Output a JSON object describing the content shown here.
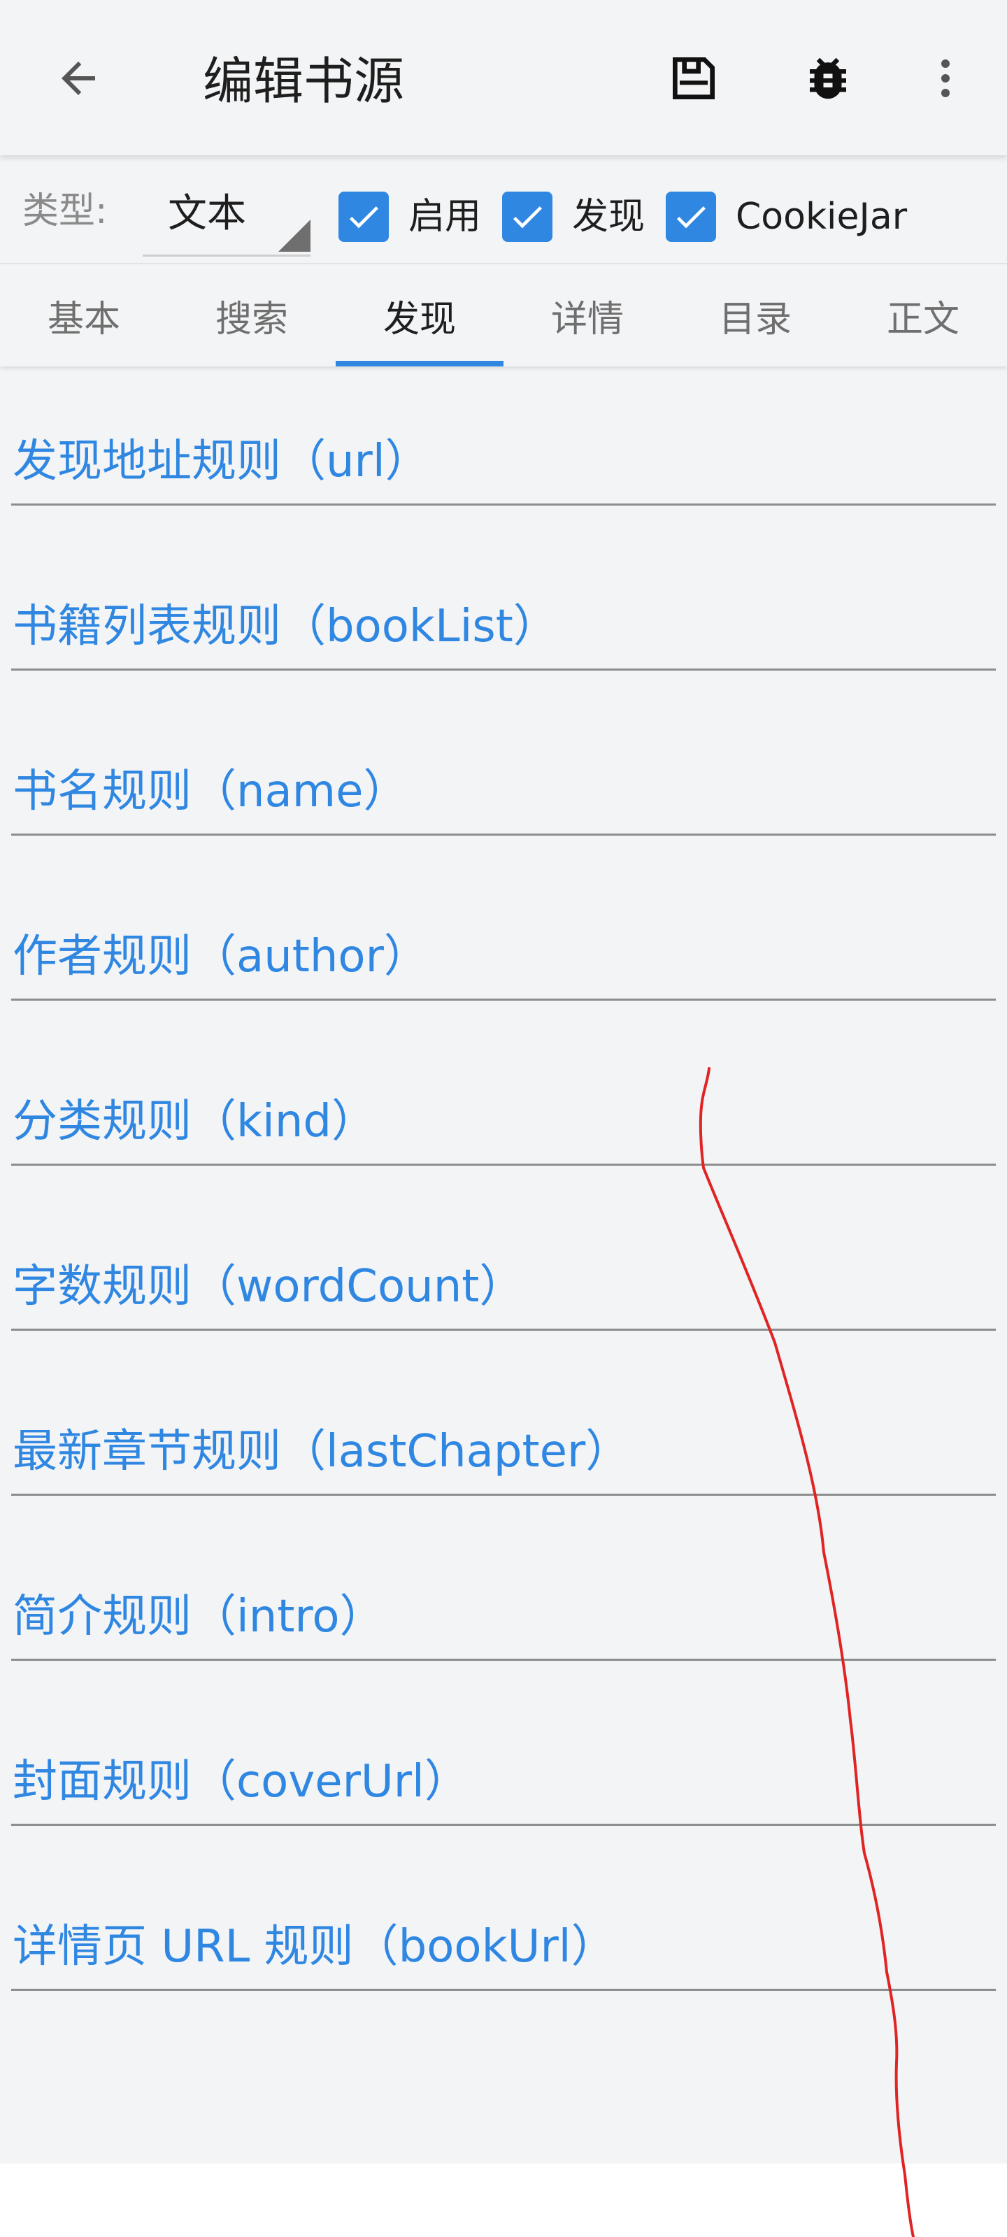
{
  "appbar": {
    "title": "编辑书源",
    "icons": [
      "arrow-back-icon",
      "save-icon",
      "bug-icon",
      "more-vert-icon"
    ]
  },
  "options": {
    "type_label": "类型:",
    "type_value": "文本",
    "checkboxes": [
      {
        "label": "启用",
        "checked": true
      },
      {
        "label": "发现",
        "checked": true
      },
      {
        "label": "CookieJar",
        "checked": true
      }
    ]
  },
  "tabs": [
    {
      "label": "基本"
    },
    {
      "label": "搜索"
    },
    {
      "label": "发现",
      "active": true
    },
    {
      "label": "详情"
    },
    {
      "label": "目录"
    },
    {
      "label": "正文"
    }
  ],
  "fields": [
    {
      "label": "发现地址规则（url）"
    },
    {
      "label": "书籍列表规则（bookList）"
    },
    {
      "label": "书名规则（name）"
    },
    {
      "label": "作者规则（author）"
    },
    {
      "label": "分类规则（kind）"
    },
    {
      "label": "字数规则（wordCount）"
    },
    {
      "label": "最新章节规则（lastChapter）"
    },
    {
      "label": "简介规则（intro）"
    },
    {
      "label": "封面规则（coverUrl）"
    },
    {
      "label": "详情页 URL 规则（bookUrl）"
    }
  ],
  "colors": {
    "accent": "#2f87e2",
    "background": "#f3f4f6",
    "scribble": "#e02424"
  }
}
